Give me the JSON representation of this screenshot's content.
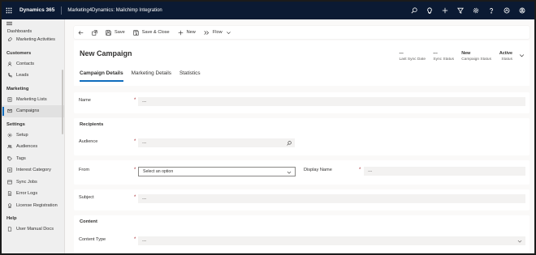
{
  "topbar": {
    "brand": "Dynamics 365",
    "app_name": "Marketing4Dynamics: Mailchimp Integration",
    "icons": [
      "search-icon",
      "lightbulb-icon",
      "plus-icon",
      "filter-icon",
      "gear-icon",
      "help-icon",
      "copilot-icon",
      "user-icon"
    ]
  },
  "sidebar": {
    "cut_item": "Dashboards",
    "items_top": [
      {
        "label": "Marketing Activities",
        "icon": "rocket-icon"
      }
    ],
    "groups": [
      {
        "title": "Customers",
        "items": [
          {
            "label": "Contacts",
            "icon": "person-icon"
          },
          {
            "label": "Leads",
            "icon": "phone-icon"
          }
        ]
      },
      {
        "title": "Marketing",
        "items": [
          {
            "label": "Marketing Lists",
            "icon": "list-icon"
          },
          {
            "label": "Campaigns",
            "icon": "campaign-icon",
            "active": true
          }
        ]
      },
      {
        "title": "Settings",
        "items": [
          {
            "label": "Setup",
            "icon": "gear-icon"
          },
          {
            "label": "Audiences",
            "icon": "people-icon"
          },
          {
            "label": "Tags",
            "icon": "tag-icon"
          },
          {
            "label": "Interest Category",
            "icon": "category-icon"
          },
          {
            "label": "Sync Jobs",
            "icon": "sync-icon"
          },
          {
            "label": "Error Logs",
            "icon": "log-icon"
          },
          {
            "label": "License Registration",
            "icon": "license-icon"
          }
        ]
      },
      {
        "title": "Help",
        "items": [
          {
            "label": "User Manual Docs",
            "icon": "doc-icon"
          }
        ]
      }
    ]
  },
  "commandbar": {
    "save": "Save",
    "save_close": "Save & Close",
    "new": "New",
    "flow": "Flow"
  },
  "header": {
    "title": "New Campaign",
    "fields": [
      {
        "value": "---",
        "label": "Last Sync Date"
      },
      {
        "value": "---",
        "label": "Sync Status"
      },
      {
        "value": "New",
        "label": "Campaign Status"
      },
      {
        "value": "Active",
        "label": "Status"
      }
    ],
    "tabs": [
      "Campaign Details",
      "Marketing Details",
      "Statistics"
    ]
  },
  "form": {
    "name": {
      "label": "Name",
      "required": "*",
      "value": "---"
    },
    "recipients": {
      "title": "Recipients",
      "audience_label": "Audience",
      "required": "*",
      "audience_value": "---"
    },
    "from": {
      "label": "From",
      "required": "*",
      "placeholder": "Select an option",
      "display_label": "Display Name",
      "display_value": "---"
    },
    "subject": {
      "label": "Subject",
      "required": "*",
      "value": "---"
    },
    "content": {
      "title": "Content",
      "type_label": "Content Type",
      "required": "*",
      "type_value": "---"
    }
  },
  "colors": {
    "topbar": "#0b1a33",
    "accent": "#0f6cbd",
    "required": "#a4262c"
  }
}
